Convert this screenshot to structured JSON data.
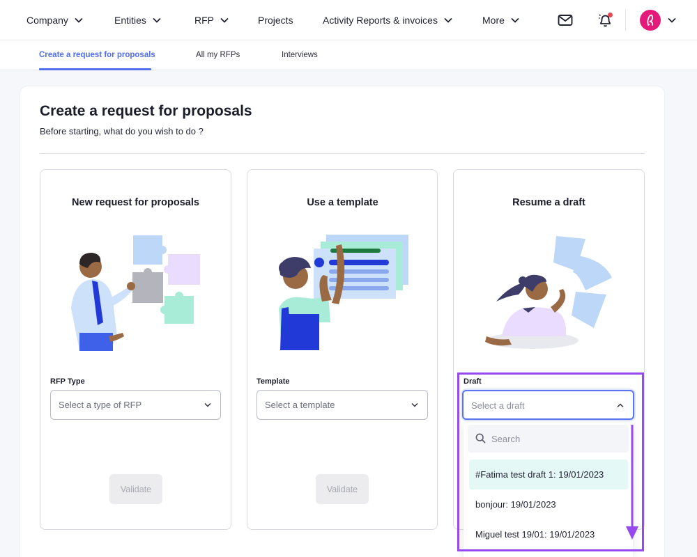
{
  "nav": {
    "items": [
      {
        "label": "Company",
        "dropdown": true
      },
      {
        "label": "Entities",
        "dropdown": true
      },
      {
        "label": "RFP",
        "dropdown": true
      },
      {
        "label": "Projects",
        "dropdown": false
      },
      {
        "label": "Activity Reports & invoices",
        "dropdown": true
      },
      {
        "label": "More",
        "dropdown": true
      }
    ],
    "icons": [
      "mail-icon",
      "bell-icon",
      "avatar"
    ],
    "notification_dot_color": "#e5484d",
    "avatar_color": "#e5197a"
  },
  "subtabs": {
    "items": [
      {
        "label": "Create a request for proposals",
        "active": true
      },
      {
        "label": "All my RFPs",
        "active": false
      },
      {
        "label": "Interviews",
        "active": false
      }
    ],
    "accent_color": "#4f6ef0"
  },
  "page": {
    "title": "Create a request for proposals",
    "subtitle": "Before starting, what do you wish to do ?"
  },
  "cards": [
    {
      "title": "New request for proposals",
      "field_label": "RFP Type",
      "select_placeholder": "Select a type of RFP",
      "button_label": "Validate",
      "button_enabled": false
    },
    {
      "title": "Use a template",
      "field_label": "Template",
      "select_placeholder": "Select a template",
      "button_label": "Validate",
      "button_enabled": false
    },
    {
      "title": "Resume a draft",
      "field_label": "Draft",
      "select_placeholder": "Select a draft",
      "dropdown_open": true,
      "search_placeholder": "Search",
      "options": [
        {
          "label": "#Fatima test draft 1: 19/01/2023",
          "highlighted": true
        },
        {
          "label": "bonjour: 19/01/2023",
          "highlighted": false
        },
        {
          "label": "Miguel test 19/01: 19/01/2023",
          "highlighted": false
        }
      ]
    }
  ],
  "annotation": {
    "color": "#9549ee"
  }
}
